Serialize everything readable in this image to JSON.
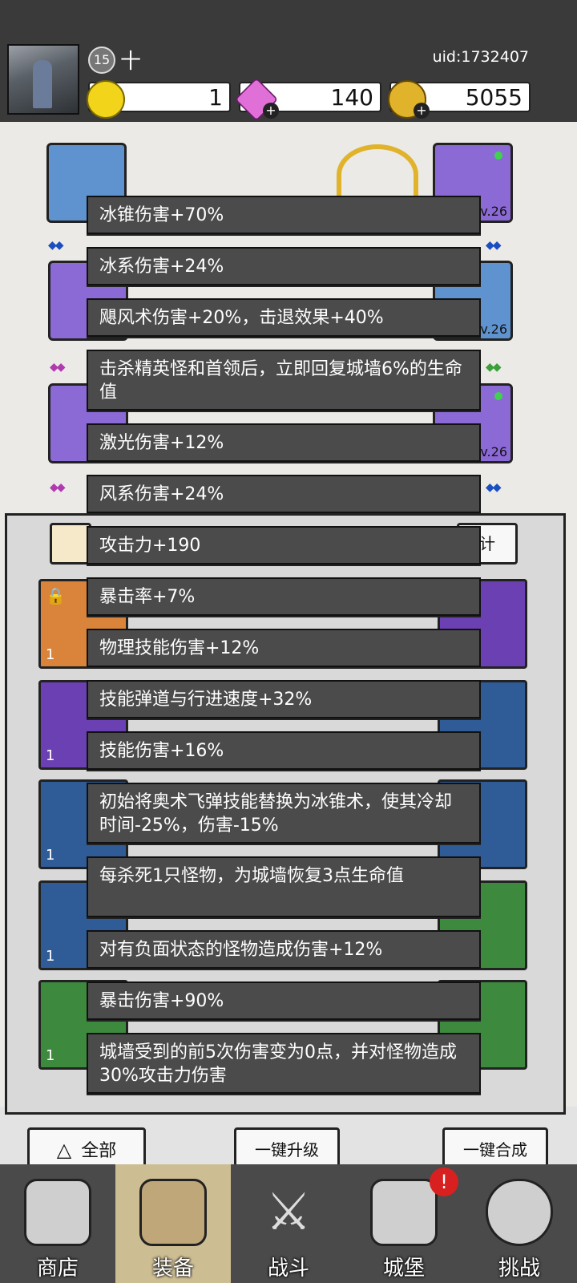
{
  "header": {
    "level": "15",
    "player_name": "十",
    "uid": "uid:1732407",
    "resources": [
      {
        "name": "energy",
        "icon": "yellow-gem-icon",
        "value": "1"
      },
      {
        "name": "diamond",
        "icon": "pink-diamond-icon",
        "value": "140"
      },
      {
        "name": "gold",
        "icon": "gold-coin-icon",
        "value": "5055"
      }
    ]
  },
  "equipment": {
    "left_slots": [
      {
        "icon": "helmet-icon",
        "color": "#5f93d0"
      },
      {
        "icon": "shoulder-armor-icon",
        "color": "#8c6ad6"
      },
      {
        "icon": "boots-icon",
        "color": "#8c6ad6"
      }
    ],
    "right_slots": [
      {
        "icon": "pipe-weapon-icon",
        "level": "Lv.26",
        "color": "#8c6ad6"
      },
      {
        "icon": "ring-icon",
        "level": "Lv.26",
        "color": "#5f93d0"
      },
      {
        "icon": "necklace-icon",
        "level": "Lv.26",
        "color": "#8c6ad6"
      }
    ],
    "stats_button_fragment": "计"
  },
  "inventory_cards": [
    {
      "color": "orange",
      "count": "1",
      "locked": true
    },
    {
      "color": "purple",
      "count": "1",
      "locked": false
    },
    {
      "color": "blue",
      "count": "1",
      "locked": false
    },
    {
      "color": "blue",
      "count": "1",
      "locked": false
    },
    {
      "color": "green",
      "count": "1",
      "locked": false
    }
  ],
  "right_cards": [
    {
      "color": "purple"
    },
    {
      "color": "blue"
    },
    {
      "color": "blue"
    },
    {
      "color": "green"
    },
    {
      "color": "green"
    }
  ],
  "tooltip_lines": [
    "冰锥伤害+70%",
    "冰系伤害+24%",
    "飓风术伤害+20%，击退效果+40%",
    "击杀精英怪和首领后，立即回复城墙6%的生命值",
    "激光伤害+12%",
    "风系伤害+24%",
    "攻击力+190",
    "暴击率+7%",
    "物理技能伤害+12%",
    "技能弹道与行进速度+32%",
    "技能伤害+16%",
    "初始将奥术飞弹技能替换为冰锥术，使其冷却时间-25%，伤害-15%",
    "每杀死1只怪物，为城墙恢复3点生命值",
    "对有负面状态的怪物造成伤害+12%",
    "暴击伤害+90%",
    "城墙受到的前5次伤害变为0点，并对怪物造成30%攻击力伤害"
  ],
  "actions": {
    "filter_label": "全部",
    "upgrade_all_label": "一键升级",
    "merge_all_label": "一键合成"
  },
  "nav": [
    {
      "label": "商店",
      "icon": "shop-icon"
    },
    {
      "label": "装备",
      "icon": "backpack-icon",
      "active": true
    },
    {
      "label": "战斗",
      "icon": "crossed-swords-icon"
    },
    {
      "label": "城堡",
      "icon": "castle-icon",
      "badge": "!"
    },
    {
      "label": "挑战",
      "icon": "shield-icon"
    }
  ]
}
